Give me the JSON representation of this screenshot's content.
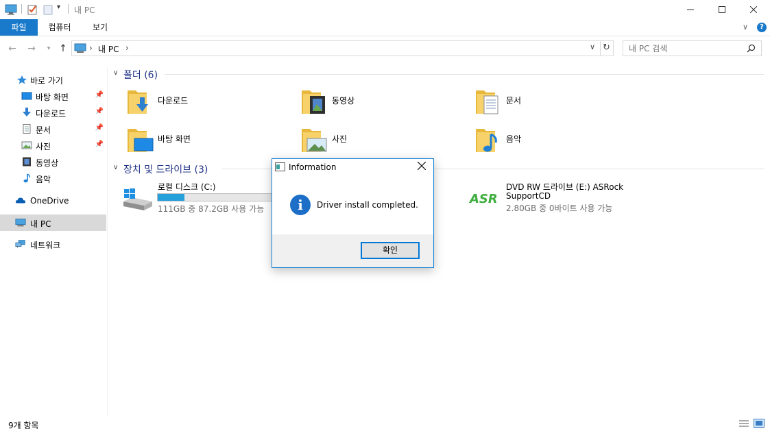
{
  "window": {
    "title": "내 PC",
    "controls": [
      "minimize-icon",
      "maximize-icon",
      "close-icon"
    ]
  },
  "ribbon": {
    "tabs": [
      "파일",
      "컴퓨터",
      "보기"
    ],
    "accent": "#1979ca"
  },
  "address": {
    "location": "내 PC",
    "search_placeholder": "내 PC 검색"
  },
  "sidebar": {
    "quick_access": "바로 가기",
    "pinned": [
      {
        "label": "바탕 화면",
        "icon": "desktop-icon",
        "pinned": true
      },
      {
        "label": "다운로드",
        "icon": "download-icon",
        "pinned": true
      },
      {
        "label": "문서",
        "icon": "document-icon",
        "pinned": true
      },
      {
        "label": "사진",
        "icon": "pictures-icon",
        "pinned": true
      },
      {
        "label": "동영상",
        "icon": "video-icon",
        "pinned": false
      },
      {
        "label": "음악",
        "icon": "music-icon",
        "pinned": false
      }
    ],
    "onedrive": "OneDrive",
    "this_pc": "내 PC",
    "network": "네트워크"
  },
  "folders": {
    "header": "폴더 (6)",
    "items": [
      {
        "label": "다운로드",
        "icon": "download-folder-icon"
      },
      {
        "label": "동영상",
        "icon": "video-folder-icon"
      },
      {
        "label": "문서",
        "icon": "documents-folder-icon"
      },
      {
        "label": "바탕 화면",
        "icon": "desktop-folder-icon"
      },
      {
        "label": "사진",
        "icon": "pictures-folder-icon"
      },
      {
        "label": "음악",
        "icon": "music-folder-icon"
      }
    ]
  },
  "devices": {
    "header": "장치 및 드라이브 (3)",
    "items": [
      {
        "label": "로컬 디스크 (C:)",
        "detail": "111GB 중 87.2GB 사용 가능",
        "used_fraction": 0.21,
        "icon": "windows-drive-icon"
      },
      {
        "label": "DVD RW 드라이브 (E:) ASRock",
        "label2": "SupportCD",
        "detail": "2.80GB 중 0바이트 사용 가능",
        "icon": "asrock-logo-icon"
      }
    ]
  },
  "status": {
    "items_count": "9개 항목"
  },
  "dialog": {
    "title": "Information",
    "message": "Driver install completed.",
    "ok_label": "확인",
    "icon": "info-icon",
    "accent": "#0078d7"
  }
}
